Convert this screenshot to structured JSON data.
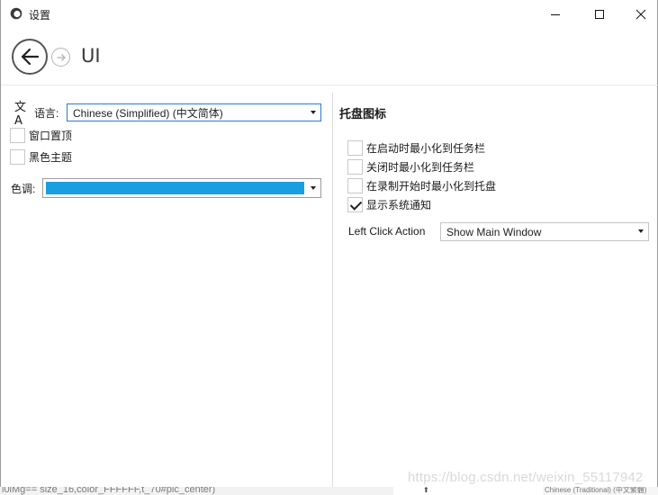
{
  "window": {
    "title": "设置",
    "icon": "app-ring-icon",
    "controls": {
      "minimize": "minimize-icon",
      "maximize": "maximize-icon",
      "close": "close-icon"
    }
  },
  "header": {
    "title": "UI",
    "back_icon": "arrow-left-icon",
    "forward_icon": "arrow-right-icon"
  },
  "left": {
    "language": {
      "icon": "translate-icon",
      "icon_glyph": "文A",
      "label": "语言:",
      "selected": "Chinese (Simplified) (中文简体)"
    },
    "checkboxes": [
      {
        "label": "窗口置顶",
        "checked": false
      },
      {
        "label": "黑色主题",
        "checked": false
      }
    ],
    "accent": {
      "label": "色调:",
      "color": "#1a9ee2"
    }
  },
  "right": {
    "section_title": "托盘图标",
    "checkboxes": [
      {
        "label": "在启动时最小化到任务栏",
        "checked": false
      },
      {
        "label": "关闭时最小化到任务栏",
        "checked": false
      },
      {
        "label": "在录制开始时最小化到托盘",
        "checked": false
      },
      {
        "label": "显示系统通知",
        "checked": true
      }
    ],
    "left_click_action": {
      "label": "Left Click Action",
      "selected": "Show Main Window"
    }
  },
  "watermark": "https://blog.csdn.net/weixin_55117942",
  "bottom": {
    "left_text": "l0lMg== size_16,color_FFFFFF,t_70#pic_center)",
    "right_text": "Chinese (Traditional) (中文繁體)"
  },
  "colors": {
    "accent": "#1a9ee2",
    "focus_border": "#2a7ad2"
  }
}
